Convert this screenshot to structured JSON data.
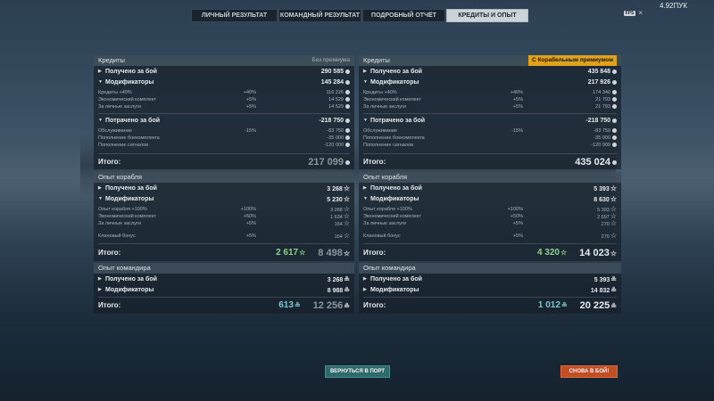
{
  "tabs": [
    {
      "label": "ЛИЧНЫЙ РЕЗУЛЬТАТ"
    },
    {
      "label": "КОМАНДНЫЙ РЕЗУЛЬТАТ"
    },
    {
      "label": "ПОДРОБНЫЙ ОТЧЁТ"
    },
    {
      "label": "КРЕДИТЫ И ОПЫТ"
    }
  ],
  "top_right": {
    "value": "4.92ПУК",
    "badge": "FPS",
    "close": "×"
  },
  "left": {
    "credits": {
      "title": "Кредиты",
      "mode": "Без премиума",
      "earned": {
        "label": "Получено за бой",
        "value": "290 585"
      },
      "mods": {
        "label": "Модификаторы",
        "value": "145 284"
      },
      "mod_rows": [
        {
          "label": "Кредиты +40%",
          "pct": "+40%",
          "value": "116 226"
        },
        {
          "label": "Экономический комплект",
          "pct": "+5%",
          "value": "14 529"
        },
        {
          "label": "За личные заслуги",
          "pct": "+5%",
          "value": "14 529"
        }
      ],
      "spent": {
        "label": "Потрачено за бой",
        "value": "-218 750"
      },
      "spent_rows": [
        {
          "label": "Обслуживание",
          "pct": "-15%",
          "value": "-83 750"
        },
        {
          "label": "Пополнение боекомплекта",
          "pct": "",
          "value": "-35 000"
        },
        {
          "label": "Пополнение сигналов",
          "pct": "",
          "value": "-120 000"
        }
      ],
      "total_label": "Итого:",
      "total": "217 099"
    },
    "ship": {
      "title": "Опыт корабля",
      "earned": {
        "label": "Получено за бой",
        "value": "3 268"
      },
      "mods": {
        "label": "Модификаторы",
        "value": "5 230"
      },
      "mod_rows": [
        {
          "label": "Опыт корабля +100%",
          "pct": "+100%",
          "value": "3 268"
        },
        {
          "label": "Экономический комплект",
          "pct": "+50%",
          "value": "1 634"
        },
        {
          "label": "За личные заслуги",
          "pct": "+5%",
          "value": "164"
        },
        {
          "label": "Клановый бонус",
          "pct": "+5%",
          "value": "164"
        }
      ],
      "total_label": "Итого:",
      "free": "2 617",
      "total": "8 498"
    },
    "commander": {
      "title": "Опыт командира",
      "earned": {
        "label": "Получено за бой",
        "value": "3 268"
      },
      "mods": {
        "label": "Модификаторы",
        "value": "8 988"
      },
      "total_label": "Итого:",
      "free": "613",
      "total": "12 256"
    }
  },
  "right": {
    "credits": {
      "title": "Кредиты",
      "mode": "С Корабельным премиумом",
      "earned": {
        "label": "Получено за бой",
        "value": "435 848"
      },
      "mods": {
        "label": "Модификаторы",
        "value": "217 926"
      },
      "mod_rows": [
        {
          "label": "Кредиты +40%",
          "pct": "+40%",
          "value": "174 340"
        },
        {
          "label": "Экономический комплект",
          "pct": "+5%",
          "value": "21 793"
        },
        {
          "label": "За личные заслуги",
          "pct": "+5%",
          "value": "21 793"
        }
      ],
      "spent": {
        "label": "Потрачено за бой",
        "value": "-218 750"
      },
      "spent_rows": [
        {
          "label": "Обслуживание",
          "pct": "-15%",
          "value": "-83 750"
        },
        {
          "label": "Пополнение боекомплекта",
          "pct": "",
          "value": "-35 000"
        },
        {
          "label": "Пополнение сигналов",
          "pct": "",
          "value": "-120 000"
        }
      ],
      "total_label": "Итого:",
      "total": "435 024"
    },
    "ship": {
      "title": "Опыт корабля",
      "earned": {
        "label": "Получено за бой",
        "value": "5 393"
      },
      "mods": {
        "label": "Модификаторы",
        "value": "8 630"
      },
      "mod_rows": [
        {
          "label": "Опыт корабля +100%",
          "pct": "+100%",
          "value": "5 393"
        },
        {
          "label": "Экономический комплект",
          "pct": "+50%",
          "value": "2 697"
        },
        {
          "label": "За личные заслуги",
          "pct": "+5%",
          "value": "270"
        },
        {
          "label": "Клановый бонус",
          "pct": "+5%",
          "value": "270"
        }
      ],
      "total_label": "Итого:",
      "free": "4 320",
      "total": "14 023"
    },
    "commander": {
      "title": "Опыт командира",
      "earned": {
        "label": "Получено за бой",
        "value": "5 393"
      },
      "mods": {
        "label": "Модификаторы",
        "value": "14 832"
      },
      "total_label": "Итого:",
      "free": "1 012",
      "total": "20 225"
    }
  },
  "buttons": {
    "port": "ВЕРНУТЬСЯ В ПОРТ",
    "battle": "СНОВА В БОЙ!"
  },
  "icons": {
    "credit": "coin-icon",
    "xp": "star-icon",
    "commander": "commander-xp-icon",
    "expand": "arrow-right-icon",
    "collapse": "arrow-down-icon"
  },
  "colors": {
    "accent_premium": "#e0a21c",
    "free_xp": "#8fd18a",
    "commander_free": "#7ac7d0",
    "port_button": "#2f6a6b",
    "battle_button": "#c24e23"
  }
}
